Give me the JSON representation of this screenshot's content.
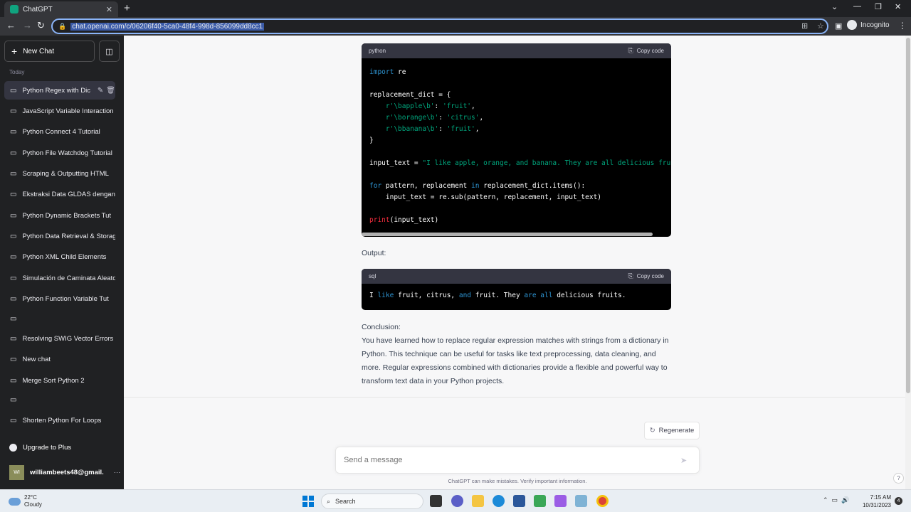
{
  "browser": {
    "tab_title": "ChatGPT",
    "tab_close": "✕",
    "new_tab": "+",
    "url": "chat.openai.com/c/06206f40-5ca0-48f4-998d-856099dd8cc1",
    "incognito_label": "Incognito"
  },
  "sidebar": {
    "new_chat_label": "New Chat",
    "section_label": "Today",
    "items": [
      {
        "label": "Python Regex with Dic",
        "active": true
      },
      {
        "label": "JavaScript Variable Interaction"
      },
      {
        "label": "Python Connect 4 Tutorial"
      },
      {
        "label": "Python File Watchdog Tutorial"
      },
      {
        "label": "Scraping & Outputting HTML"
      },
      {
        "label": "Ekstraksi Data GLDAS dengan"
      },
      {
        "label": "Python Dynamic Brackets Tut"
      },
      {
        "label": "Python Data Retrieval & Storage"
      },
      {
        "label": "Python XML Child Elements"
      },
      {
        "label": "Simulación de Caminata Aleatoria"
      },
      {
        "label": "Python Function Variable Tut"
      },
      {
        "label": ""
      },
      {
        "label": "Resolving SWIG Vector Errors"
      },
      {
        "label": "New chat"
      },
      {
        "label": "Merge Sort Python 2"
      },
      {
        "label": ""
      },
      {
        "label": "Shorten Python For Loops"
      }
    ],
    "upgrade_label": "Upgrade to Plus",
    "user_initials": "WI",
    "user_email": "williambeets48@gmail.",
    "user_more": "···"
  },
  "main": {
    "code1": {
      "language": "python",
      "copy_label": "Copy code",
      "lines": [
        [
          {
            "t": "import",
            "c": "kw"
          },
          {
            "t": " re"
          }
        ],
        [],
        [
          {
            "t": "replacement_dict = {"
          }
        ],
        [
          {
            "t": "    "
          },
          {
            "t": "r'\\bapple\\b'",
            "c": "str"
          },
          {
            "t": ": "
          },
          {
            "t": "'fruit'",
            "c": "str"
          },
          {
            "t": ","
          }
        ],
        [
          {
            "t": "    "
          },
          {
            "t": "r'\\borange\\b'",
            "c": "str"
          },
          {
            "t": ": "
          },
          {
            "t": "'citrus'",
            "c": "str"
          },
          {
            "t": ","
          }
        ],
        [
          {
            "t": "    "
          },
          {
            "t": "r'\\bbanana\\b'",
            "c": "str"
          },
          {
            "t": ": "
          },
          {
            "t": "'fruit'",
            "c": "str"
          },
          {
            "t": ","
          }
        ],
        [
          {
            "t": "}"
          }
        ],
        [],
        [
          {
            "t": "input_text = "
          },
          {
            "t": "\"I like apple, orange, and banana. They are all delicious fruits.\"",
            "c": "str"
          }
        ],
        [],
        [
          {
            "t": "for",
            "c": "kw"
          },
          {
            "t": " pattern, replacement "
          },
          {
            "t": "in",
            "c": "kw"
          },
          {
            "t": " replacement_dict.items():"
          }
        ],
        [
          {
            "t": "    input_text = re.sub(pattern, replacement, input_text)"
          }
        ],
        [],
        [
          {
            "t": "print",
            "c": "fn"
          },
          {
            "t": "(input_text)"
          }
        ]
      ]
    },
    "output_label": "Output:",
    "code2": {
      "language": "sql",
      "copy_label": "Copy code",
      "lines": [
        [
          {
            "t": "I "
          },
          {
            "t": "like",
            "c": "kw"
          },
          {
            "t": " fruit, citrus, "
          },
          {
            "t": "and",
            "c": "kw"
          },
          {
            "t": " fruit. They "
          },
          {
            "t": "are",
            "c": "kw"
          },
          {
            "t": " "
          },
          {
            "t": "all",
            "c": "kw"
          },
          {
            "t": " delicious fruits."
          }
        ]
      ]
    },
    "conclusion_heading": "Conclusion:",
    "conclusion_text": "You have learned how to replace regular expression matches with strings from a dictionary in Python. This technique can be useful for tasks like text preprocessing, data cleaning, and more. Regular expressions combined with dictionaries provide a flexible and powerful way to transform text data in your Python projects.",
    "regenerate_label": "Regenerate",
    "composer_placeholder": "Send a message",
    "disclaimer": "ChatGPT can make mistakes. Verify important information.",
    "help_label": "?"
  },
  "taskbar": {
    "temperature": "22°C",
    "weather": "Cloudy",
    "search_label": "Search",
    "time": "7:15 AM",
    "date": "10/31/2023",
    "notification_count": "4"
  }
}
